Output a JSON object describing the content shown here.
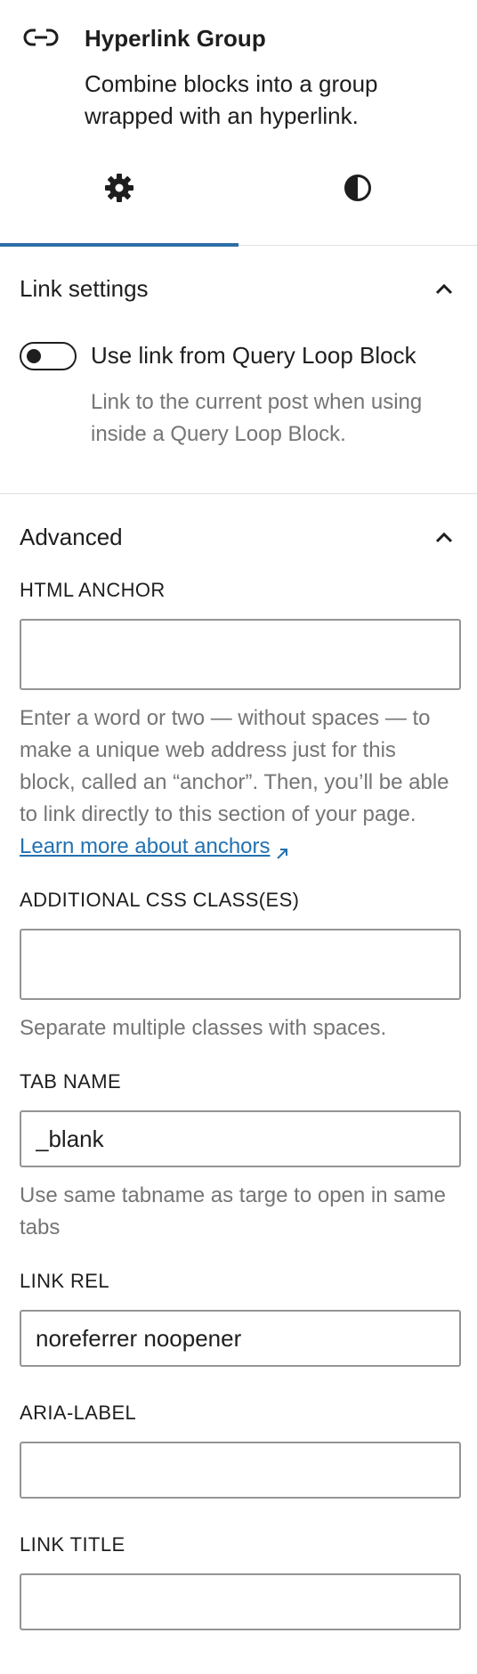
{
  "block": {
    "icon": "link-icon",
    "title": "Hyperlink Group",
    "description": "Combine blocks into a group wrapped with an hyperlink."
  },
  "tabs": [
    {
      "icon": "gear-icon",
      "label": "Settings",
      "active": true
    },
    {
      "icon": "half-circle-icon",
      "label": "Styles",
      "active": false
    }
  ],
  "link_settings": {
    "title": "Link settings",
    "toggle_label": "Use link from Query Loop Block",
    "toggle_help": "Link to the current post when using inside a Query Loop Block.",
    "toggle_on": false
  },
  "advanced": {
    "title": "Advanced",
    "html_anchor": {
      "label": "HTML ANCHOR",
      "value": "",
      "help_text": "Enter a word or two — without spaces — to make a unique web address just for this block, called an “anchor”. Then, you’ll be able to link directly to this section of your page.",
      "help_link": "Learn more about anchors"
    },
    "css_classes": {
      "label": "ADDITIONAL CSS CLASS(ES)",
      "value": "",
      "help_text": "Separate multiple classes with spaces."
    },
    "tab_name": {
      "label": "TAB NAME",
      "value": "_blank",
      "help_text": "Use same tabname as targe to open in same tabs"
    },
    "link_rel": {
      "label": "LINK REL",
      "value": "noreferrer noopener"
    },
    "aria_label": {
      "label": "ARIA-LABEL",
      "value": ""
    },
    "link_title": {
      "label": "LINK TITLE",
      "value": ""
    }
  },
  "colors": {
    "accent": "#2c6ea6",
    "link": "#2271b1",
    "help_text": "#757575",
    "border": "#949494"
  }
}
